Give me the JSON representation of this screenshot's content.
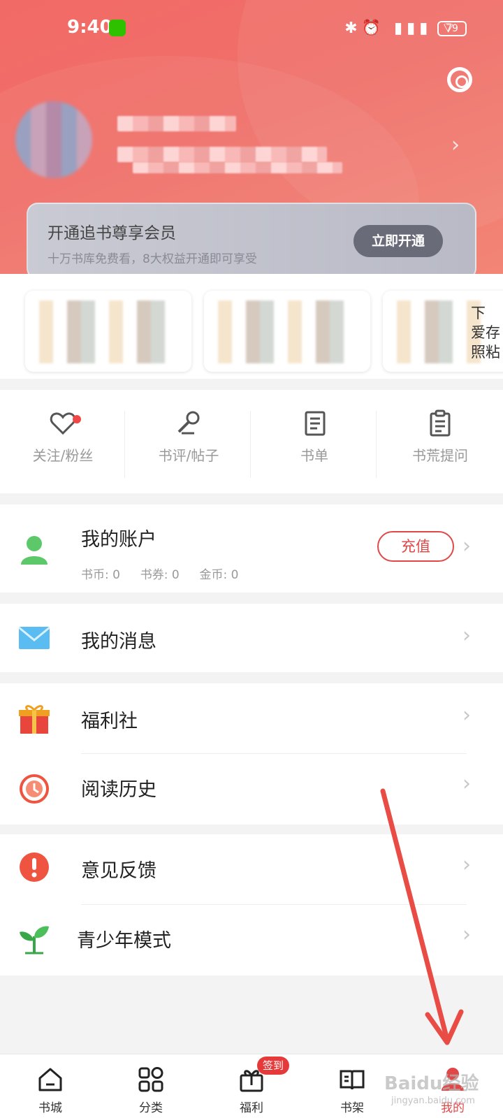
{
  "status_bar": {
    "time": "9:40",
    "battery": "79",
    "icons": "✱⏰ ▮▮▮ ⌔"
  },
  "vip": {
    "title": "开通追书尊享会员",
    "subtitle": "十万书库免费看，8大权益开通即可享受",
    "button": "立即开通"
  },
  "book_cards": [
    {
      "edge_text": ""
    },
    {
      "edge_text": ""
    },
    {
      "edge_text": "下\n爱存\n照粘"
    }
  ],
  "quick_actions": [
    {
      "label": "关注/粉丝",
      "icon": "heart-icon"
    },
    {
      "label": "书评/帖子",
      "icon": "microphone-icon"
    },
    {
      "label": "书单",
      "icon": "booklist-icon"
    },
    {
      "label": "书荒提问",
      "icon": "clipboard-icon"
    }
  ],
  "account": {
    "title": "我的账户",
    "coins": "书币: 0",
    "vouchers": "书券: 0",
    "gold": "金币: 0",
    "recharge": "充值"
  },
  "menu": {
    "messages": "我的消息",
    "welfare": "福利社",
    "history": "阅读历史",
    "feedback": "意见反馈",
    "teen_mode": "青少年模式"
  },
  "tabs": [
    {
      "label": "书城",
      "icon": "home-icon"
    },
    {
      "label": "分类",
      "icon": "category-icon"
    },
    {
      "label": "福利",
      "icon": "gift-icon"
    },
    {
      "label": "书架",
      "icon": "bookshelf-icon"
    },
    {
      "label": "我的",
      "icon": "profile-icon"
    }
  ],
  "tab_badge": "签到",
  "colors": {
    "header": "#f26a66",
    "accent": "#e04848"
  },
  "watermark": {
    "brand": "Baidu经验",
    "url": "jingyan.baidu.com"
  }
}
